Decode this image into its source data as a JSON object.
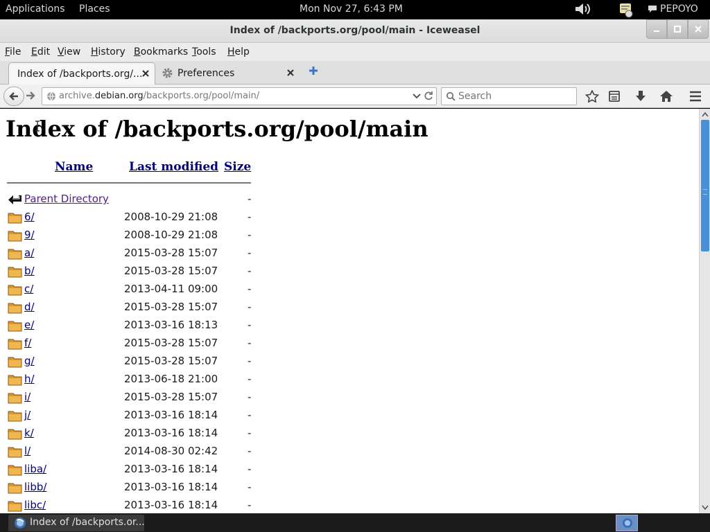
{
  "topbar": {
    "applications": "Applications",
    "places": "Places",
    "clock": "Mon Nov 27,  6:43 PM",
    "user": "PEPOYO"
  },
  "window": {
    "title": "Index of /backports.org/pool/main - Iceweasel"
  },
  "menubar": {
    "items": [
      {
        "label": "File",
        "mnemonic": "F",
        "rest": "ile"
      },
      {
        "label": "Edit",
        "mnemonic": "E",
        "rest": "dit"
      },
      {
        "label": "View",
        "mnemonic": "V",
        "rest": "iew"
      },
      {
        "label": "History",
        "mnemonic": "H",
        "rest": "istory"
      },
      {
        "label": "Bookmarks",
        "mnemonic": "B",
        "rest": "ookmarks"
      },
      {
        "label": "Tools",
        "mnemonic": "T",
        "rest": "ools"
      },
      {
        "label": "Help",
        "mnemonic": "H",
        "rest": "elp"
      }
    ]
  },
  "tabs": [
    {
      "label": "Index of /backports.org/..."
    },
    {
      "label": "Preferences"
    }
  ],
  "navbar": {
    "url_prefix": "archive.",
    "url_domain": "debian.org",
    "url_path": "/backports.org/pool/main/",
    "search_placeholder": "Search"
  },
  "page": {
    "heading": "Index of /backports.org/pool/main",
    "columns": {
      "name": "Name",
      "modified": "Last modified",
      "size": "Size"
    },
    "parent": {
      "name": "Parent Directory",
      "date": "",
      "size": "-"
    },
    "entries": [
      {
        "name": "6/",
        "date": "2008-10-29 21:08",
        "size": "-"
      },
      {
        "name": "9/",
        "date": "2008-10-29 21:08",
        "size": "-"
      },
      {
        "name": "a/",
        "date": "2015-03-28 15:07",
        "size": "-"
      },
      {
        "name": "b/",
        "date": "2015-03-28 15:07",
        "size": "-"
      },
      {
        "name": "c/",
        "date": "2013-04-11 09:00",
        "size": "-"
      },
      {
        "name": "d/",
        "date": "2015-03-28 15:07",
        "size": "-"
      },
      {
        "name": "e/",
        "date": "2013-03-16 18:13",
        "size": "-"
      },
      {
        "name": "f/",
        "date": "2015-03-28 15:07",
        "size": "-"
      },
      {
        "name": "g/",
        "date": "2015-03-28 15:07",
        "size": "-"
      },
      {
        "name": "h/",
        "date": "2013-06-18 21:00",
        "size": "-"
      },
      {
        "name": "i/",
        "date": "2015-03-28 15:07",
        "size": "-"
      },
      {
        "name": "j/",
        "date": "2013-03-16 18:14",
        "size": "-"
      },
      {
        "name": "k/",
        "date": "2013-03-16 18:14",
        "size": "-"
      },
      {
        "name": "l/",
        "date": "2014-08-30 02:42",
        "size": "-"
      },
      {
        "name": "liba/",
        "date": "2013-03-16 18:14",
        "size": "-"
      },
      {
        "name": "libb/",
        "date": "2013-03-16 18:14",
        "size": "-"
      },
      {
        "name": "libc/",
        "date": "2013-03-16 18:14",
        "size": "-"
      }
    ]
  },
  "taskbar": {
    "task_label": "Index of /backports.or..."
  },
  "colors": {
    "link": "#000080",
    "visited": "#551a8b",
    "folder": "#e8a33c",
    "scroll_thumb": "#4a90d9"
  }
}
